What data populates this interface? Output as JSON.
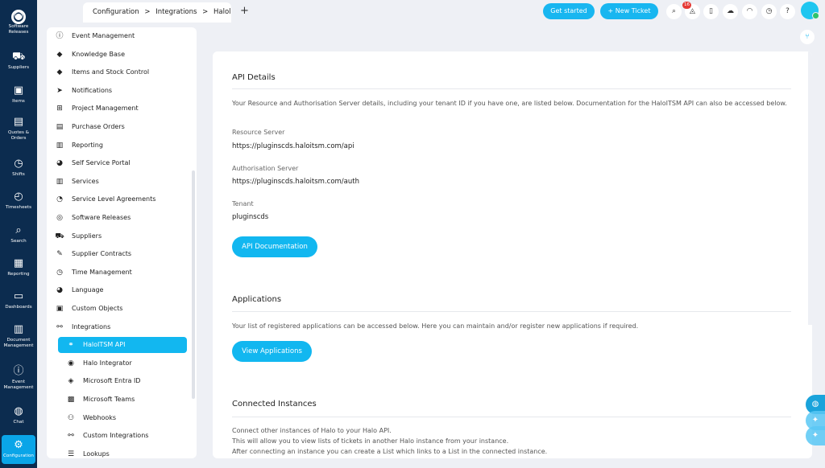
{
  "nav": {
    "items": [
      {
        "label": "Software\nReleases",
        "icon": "software-releases-icon",
        "glyph": "◎"
      },
      {
        "label": "Suppliers",
        "icon": "truck-icon",
        "glyph": "⛟"
      },
      {
        "label": "Items",
        "icon": "box-icon",
        "glyph": "▣"
      },
      {
        "label": "Quotes &\nOrders",
        "icon": "quote-icon",
        "glyph": "▤"
      },
      {
        "label": "Shifts",
        "icon": "clock-icon",
        "glyph": "◷"
      },
      {
        "label": "Timesheets",
        "icon": "timesheet-icon",
        "glyph": "◴"
      },
      {
        "label": "Search",
        "icon": "search-icon",
        "glyph": "⌕"
      },
      {
        "label": "Reporting",
        "icon": "report-icon",
        "glyph": "▦"
      },
      {
        "label": "Dashboards",
        "icon": "monitor-icon",
        "glyph": "▭"
      },
      {
        "label": "Document\nManagement",
        "icon": "document-icon",
        "glyph": "▥"
      },
      {
        "label": "Event\nManagement",
        "icon": "alert-icon",
        "glyph": "ⓘ"
      },
      {
        "label": "Chat",
        "icon": "chat-icon",
        "glyph": "◍"
      },
      {
        "label": "Configuration",
        "icon": "gear-icon",
        "glyph": "⚙"
      }
    ]
  },
  "topbar": {
    "tab_parts": [
      "Configuration",
      ">",
      "Integrations",
      ">",
      "Halol..."
    ],
    "get_started": "Get started",
    "new_ticket": "+ New Ticket",
    "notifications_count": "16"
  },
  "config_menu": [
    {
      "label": "Event Management",
      "icon": "alert-icon",
      "glyph": "ⓘ"
    },
    {
      "label": "Knowledge Base",
      "icon": "cube-icon",
      "glyph": "◆"
    },
    {
      "label": "Items and Stock Control",
      "icon": "box-icon",
      "glyph": "◆"
    },
    {
      "label": "Notifications",
      "icon": "paper-plane-icon",
      "glyph": "➤"
    },
    {
      "label": "Project Management",
      "icon": "project-icon",
      "glyph": "⊞"
    },
    {
      "label": "Purchase Orders",
      "icon": "po-icon",
      "glyph": "▤"
    },
    {
      "label": "Reporting",
      "icon": "report-icon",
      "glyph": "▥"
    },
    {
      "label": "Self Service Portal",
      "icon": "portal-icon",
      "glyph": "◕"
    },
    {
      "label": "Services",
      "icon": "services-icon",
      "glyph": "▥"
    },
    {
      "label": "Service Level Agreements",
      "icon": "sla-icon",
      "glyph": "◔"
    },
    {
      "label": "Software Releases",
      "icon": "release-icon",
      "glyph": "◎"
    },
    {
      "label": "Suppliers",
      "icon": "truck-icon",
      "glyph": "⛟"
    },
    {
      "label": "Supplier Contracts",
      "icon": "contract-icon",
      "glyph": "✎"
    },
    {
      "label": "Time Management",
      "icon": "clock-icon",
      "glyph": "◷"
    },
    {
      "label": "Language",
      "icon": "language-icon",
      "glyph": "◕"
    },
    {
      "label": "Custom Objects",
      "icon": "custom-objects-icon",
      "glyph": "▣"
    },
    {
      "label": "Integrations",
      "icon": "link-icon",
      "glyph": "⚯"
    }
  ],
  "integrations_sub": [
    {
      "label": "HaloITSM API",
      "icon": "api-icon",
      "glyph": "⚭",
      "active": true
    },
    {
      "label": "Halo Integrator",
      "icon": "integrator-icon",
      "glyph": "◉"
    },
    {
      "label": "Microsoft Entra ID",
      "icon": "entra-icon",
      "glyph": "◈"
    },
    {
      "label": "Microsoft Teams",
      "icon": "teams-icon",
      "glyph": "▩"
    },
    {
      "label": "Webhooks",
      "icon": "webhook-icon",
      "glyph": "⚇"
    },
    {
      "label": "Custom Integrations",
      "icon": "link-icon",
      "glyph": "⚯"
    }
  ],
  "config_menu_tail": {
    "label": "Lookups",
    "icon": "database-icon",
    "glyph": "☰"
  },
  "api_details": {
    "title": "API Details",
    "description": "Your Resource and Authorisation Server details, including your tenant ID if you have one, are listed below. Documentation for the HaloITSM API can also be accessed below.",
    "resource_label": "Resource Server",
    "resource_value": "https://pluginscds.haloitsm.com/api",
    "auth_label": "Authorisation Server",
    "auth_value": "https://pluginscds.haloitsm.com/auth",
    "tenant_label": "Tenant",
    "tenant_value": "pluginscds",
    "doc_button": "API Documentation"
  },
  "applications": {
    "title": "Applications",
    "description": "Your list of registered applications can be accessed below. Here you can maintain and/or register new applications if required.",
    "button": "View Applications"
  },
  "connected": {
    "title": "Connected Instances",
    "line1": "Connect other instances of Halo to your Halo API.",
    "line2": "This will allow you to view lists of tickets in another Halo instance from your instance.",
    "line3": "After connecting an instance you can create a List which links to a List in the connected instance."
  }
}
